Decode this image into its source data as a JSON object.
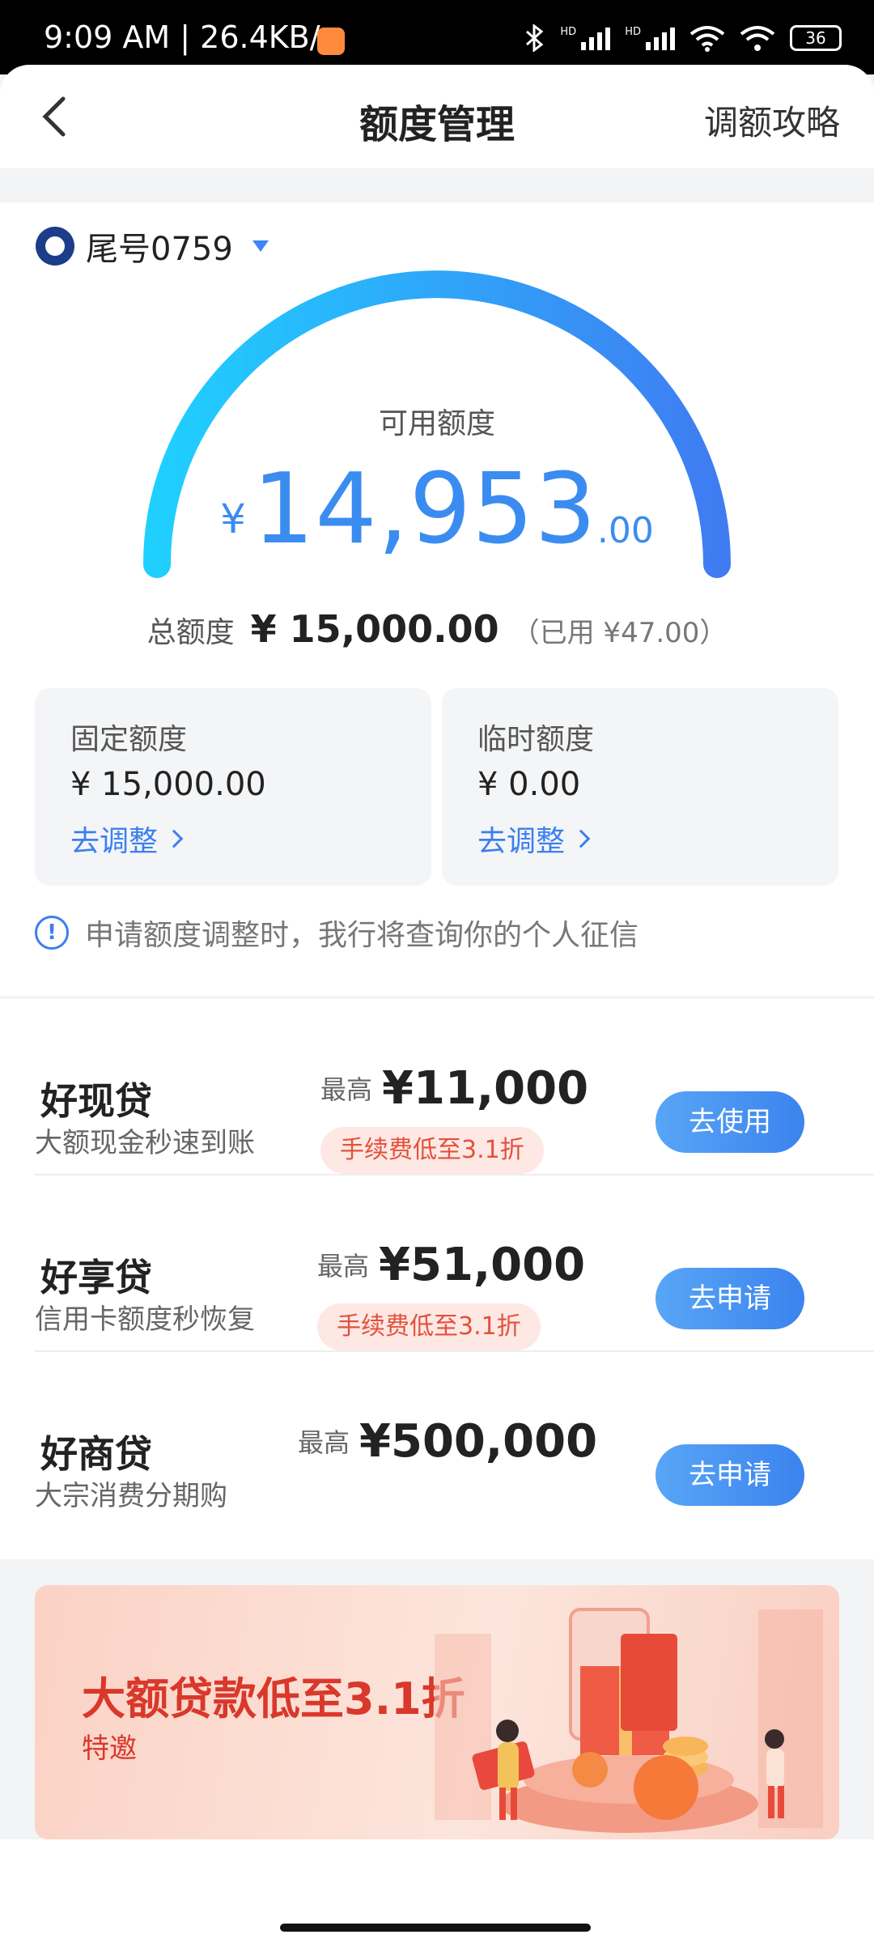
{
  "status_bar": {
    "time": "9:09 AM | 26.4KB/s",
    "hd1": "HD",
    "hd2": "HD",
    "battery": "36"
  },
  "header": {
    "title": "额度管理",
    "right_link": "调额攻略"
  },
  "account": {
    "label": "尾号0759"
  },
  "credit": {
    "available_label": "可用额度",
    "currency": "¥",
    "available_int": "14,953",
    "available_dec": ".00",
    "total_label": "总额度",
    "total_value": "¥ 15,000.00",
    "used_note": "（已用 ¥47.00）"
  },
  "quotas": {
    "fixed": {
      "title": "固定额度",
      "amount": "¥ 15,000.00",
      "action": "去调整"
    },
    "temp": {
      "title": "临时额度",
      "amount": "¥ 0.00",
      "action": "去调整"
    }
  },
  "notice": {
    "text": "申请额度调整时，我行将查询你的个人征信"
  },
  "loans": [
    {
      "name": "好现贷",
      "desc": "大额现金秒速到账",
      "max_label": "最高",
      "max_value": "¥11,000",
      "fee_tag": "手续费低至3.1折",
      "button": "去使用"
    },
    {
      "name": "好享贷",
      "desc": "信用卡额度秒恢复",
      "max_label": "最高",
      "max_value": "¥51,000",
      "fee_tag": "手续费低至3.1折",
      "button": "去申请"
    },
    {
      "name": "好商贷",
      "desc": "大宗消费分期购",
      "max_label": "最高",
      "max_value": "¥500,000",
      "button": "去申请"
    }
  ],
  "banner": {
    "title": "大额贷款低至3.1折",
    "subtitle": "特邀"
  },
  "colors": {
    "accent": "#3b8cf0",
    "gauge_start": "#1fd0ff",
    "gauge_end": "#3f7cf2",
    "promo_red": "#d9382b"
  }
}
